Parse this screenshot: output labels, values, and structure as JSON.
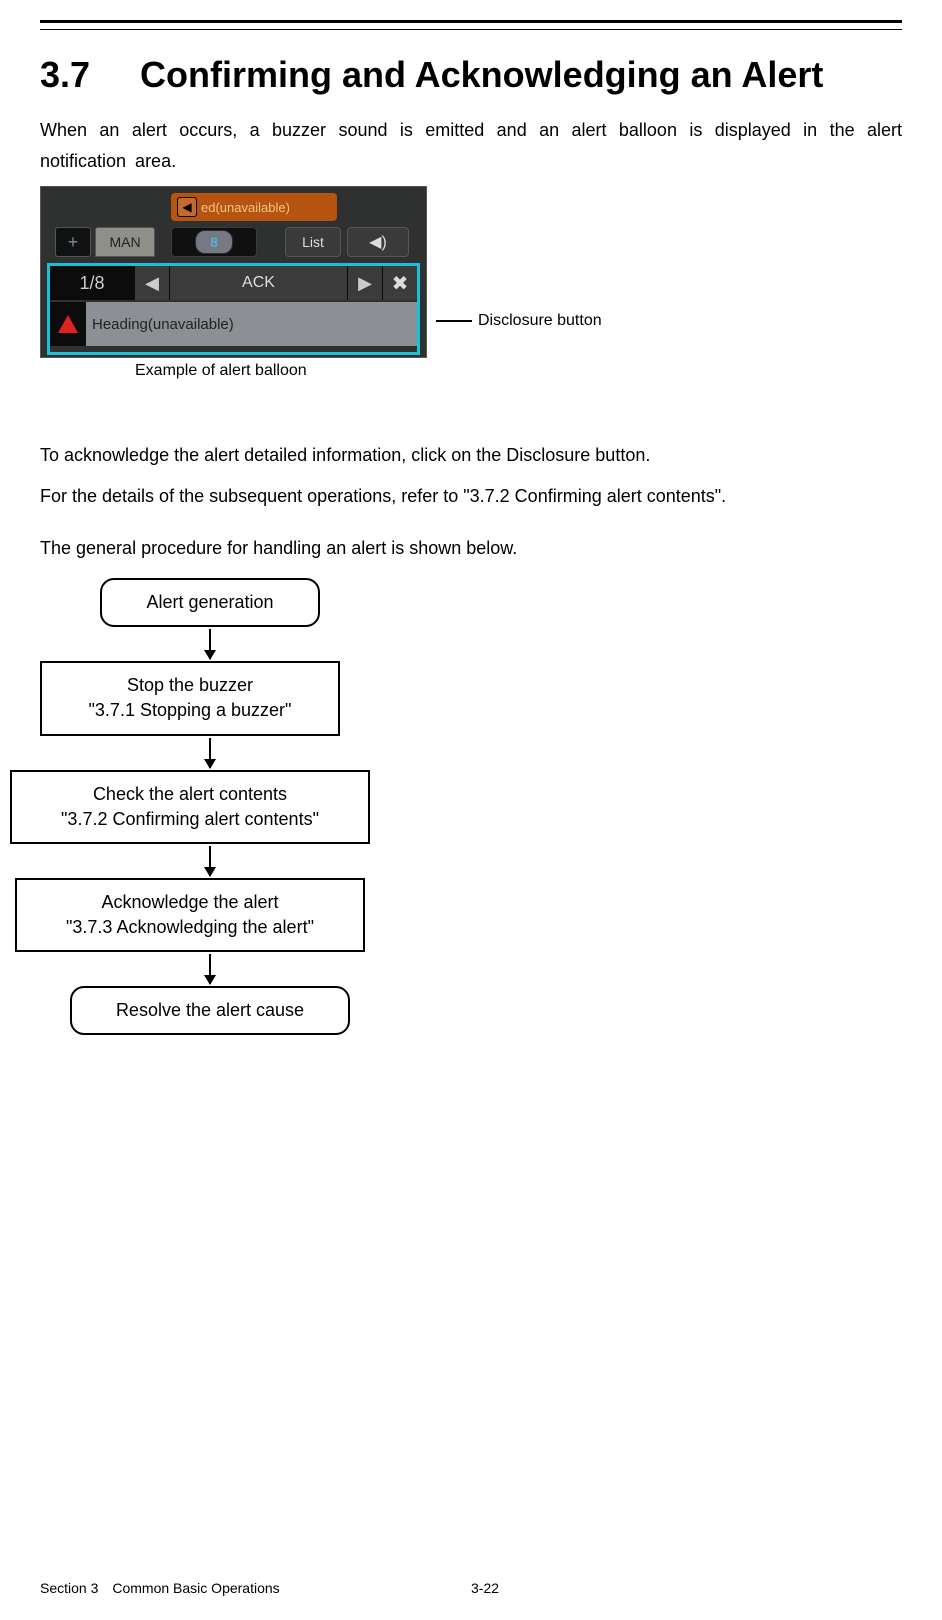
{
  "heading": {
    "number": "3.7",
    "title": "Confirming and Acknowledging an Alert"
  },
  "para": {
    "intro": "When an alert occurs, a buzzer sound is emitted and an alert balloon is displayed in the alert notification area.",
    "ack1": "To acknowledge the alert detailed information, click on the Disclosure button.",
    "ack2": "For the details of the subsequent operations, refer to \"3.7.2 Confirming alert contents\".",
    "procedure": "The general procedure for handling an alert is shown below."
  },
  "shot": {
    "top_orange": "ed(unavailable)",
    "plus": "+",
    "man": "MAN",
    "badge_num": "8",
    "list": "List",
    "page": "1/8",
    "ack": "ACK",
    "alert_text": "Heading(unavailable)",
    "close": "✖",
    "sound": "◀)",
    "left": "◀",
    "right": "▶",
    "orange_icon": "◀"
  },
  "annot": {
    "disclosure": "Disclosure button"
  },
  "caption": {
    "example": "Example of alert balloon"
  },
  "flow": {
    "n1": "Alert generation",
    "n2a": "Stop the buzzer",
    "n2b": "\"3.7.1 Stopping a buzzer\"",
    "n3a": "Check the alert contents",
    "n3b": "\"3.7.2 Confirming alert contents\"",
    "n4a": "Acknowledge the alert",
    "n4b": "\"3.7.3 Acknowledging the alert\"",
    "n5": "Resolve the alert cause"
  },
  "footer": {
    "section": "Section 3 Common Basic Operations",
    "page": "3-22"
  }
}
